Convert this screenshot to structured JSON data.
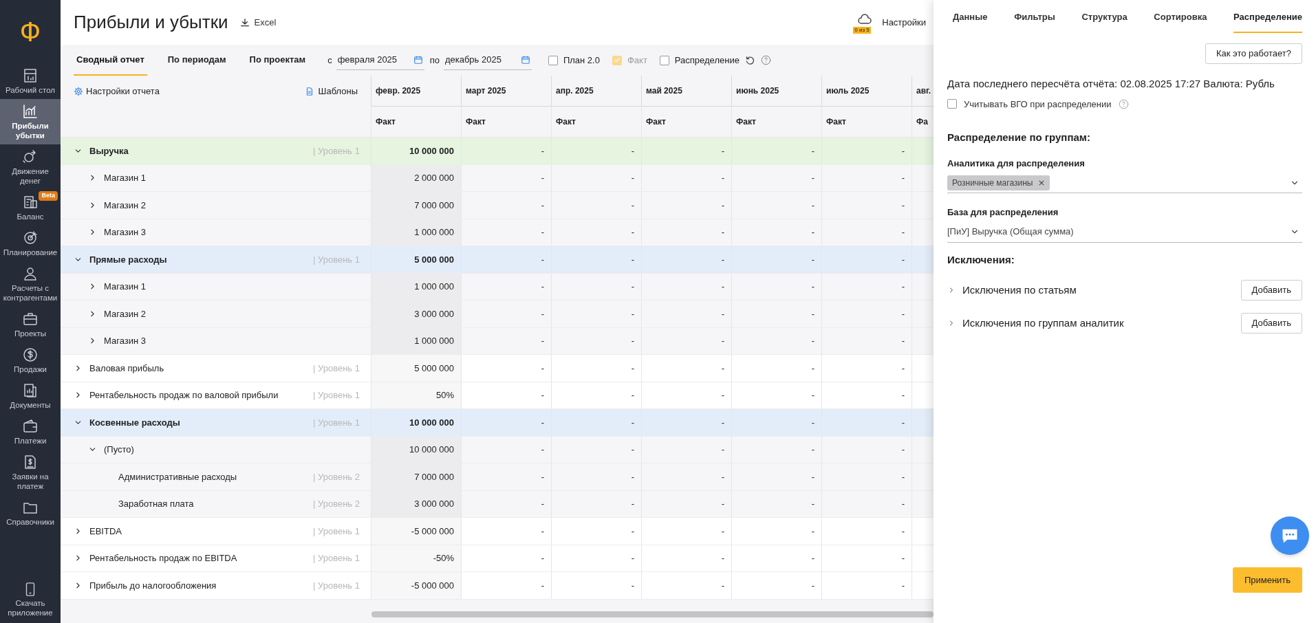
{
  "logo": "Ф",
  "sidebar": {
    "items": [
      {
        "label": "Рабочий стол",
        "selected": false
      },
      {
        "label": "Прибыли убытки",
        "selected": true
      },
      {
        "label": "Движение денег",
        "selected": false
      },
      {
        "label": "Баланс",
        "selected": false,
        "badge": "Beta"
      },
      {
        "label": "Планирование",
        "selected": false
      },
      {
        "label": "Расчеты с контрагентами",
        "selected": false
      },
      {
        "label": "Проекты",
        "selected": false
      },
      {
        "label": "Продажи",
        "selected": false
      },
      {
        "label": "Документы",
        "selected": false
      },
      {
        "label": "Платежи",
        "selected": false
      },
      {
        "label": "Заявки на платеж",
        "selected": false
      },
      {
        "label": "Справочники",
        "selected": false
      }
    ],
    "bottom": "Скачать приложение"
  },
  "header": {
    "title": "Прибыли и убытки",
    "export": "Excel",
    "counter": "0 из 5",
    "settings": "Настройки"
  },
  "toolbar": {
    "tabs": [
      {
        "label": "Сводный отчет",
        "selected": true
      },
      {
        "label": "По периодам",
        "selected": false
      },
      {
        "label": "По проектам",
        "selected": false
      }
    ],
    "from_label": "с",
    "from": "февраля 2025",
    "to_label": "по",
    "to": "декабрь 2025",
    "checks": [
      {
        "label": "План 2.0",
        "checked": false,
        "disabled": false
      },
      {
        "label": "Факт",
        "checked": true,
        "disabled": true
      },
      {
        "label": "Распределение",
        "checked": false,
        "disabled": false
      }
    ]
  },
  "table": {
    "settings": "Настройки отчета",
    "templates": "Шаблоны",
    "columns": [
      {
        "month": "февр. 2025",
        "sub": "Факт"
      },
      {
        "month": "март 2025",
        "sub": "Факт"
      },
      {
        "month": "апр. 2025",
        "sub": "Факт"
      },
      {
        "month": "май 2025",
        "sub": "Факт"
      },
      {
        "month": "июнь 2025",
        "sub": "Факт"
      },
      {
        "month": "июль 2025",
        "sub": "Факт"
      },
      {
        "month": "авг.",
        "sub": "Фа"
      }
    ],
    "rows": [
      {
        "label": "Выручка",
        "level": "| Уровень 1",
        "expanded": true,
        "bold": true,
        "color": "#e6f4e0",
        "values": [
          "10 000 000",
          "-",
          "-",
          "-",
          "-",
          "-"
        ],
        "children": [
          {
            "label": "Магазин 1",
            "expanded": false,
            "values": [
              "2 000 000",
              "-",
              "-",
              "-",
              "-",
              "-"
            ]
          },
          {
            "label": "Магазин 2",
            "expanded": false,
            "values": [
              "7 000 000",
              "-",
              "-",
              "-",
              "-",
              "-"
            ]
          },
          {
            "label": "Магазин 3",
            "expanded": false,
            "values": [
              "1 000 000",
              "-",
              "-",
              "-",
              "-",
              "-"
            ]
          }
        ]
      },
      {
        "label": "Прямые расходы",
        "level": "| Уровень 1",
        "expanded": true,
        "bold": true,
        "color": "#e3edfa",
        "values": [
          "5 000 000",
          "-",
          "-",
          "-",
          "-",
          "-"
        ],
        "children": [
          {
            "label": "Магазин 1",
            "expanded": false,
            "values": [
              "1 000 000",
              "-",
              "-",
              "-",
              "-",
              "-"
            ]
          },
          {
            "label": "Магазин 2",
            "expanded": false,
            "values": [
              "3 000 000",
              "-",
              "-",
              "-",
              "-",
              "-"
            ]
          },
          {
            "label": "Магазин 3",
            "expanded": false,
            "values": [
              "1 000 000",
              "-",
              "-",
              "-",
              "-",
              "-"
            ]
          }
        ]
      },
      {
        "label": "Валовая прибыль",
        "level": "| Уровень 1",
        "expanded": false,
        "values": [
          "5 000 000",
          "-",
          "-",
          "-",
          "-",
          "-"
        ]
      },
      {
        "label": "Рентабельность продаж по валовой прибыли",
        "level": "| Уровень 1",
        "expanded": false,
        "values": [
          "50%",
          "-",
          "-",
          "-",
          "-",
          "-"
        ]
      },
      {
        "label": "Косвенные расходы",
        "level": "| Уровень 1",
        "expanded": true,
        "bold": true,
        "color": "#e3edfa",
        "values": [
          "10 000 000",
          "-",
          "-",
          "-",
          "-",
          "-"
        ],
        "children": [
          {
            "label": "(Пусто)",
            "expanded": true,
            "values": [
              "10 000 000",
              "-",
              "-",
              "-",
              "-",
              "-"
            ],
            "children": [
              {
                "label": "Административные расходы",
                "level": "| Уровень 2",
                "values": [
                  "7 000 000",
                  "-",
                  "-",
                  "-",
                  "-",
                  "-"
                ]
              },
              {
                "label": "Заработная плата",
                "level": "| Уровень 2",
                "values": [
                  "3 000 000",
                  "-",
                  "-",
                  "-",
                  "-",
                  "-"
                ]
              }
            ]
          }
        ]
      },
      {
        "label": "EBITDA",
        "level": "| Уровень 1",
        "expanded": false,
        "values": [
          "-5 000 000",
          "-",
          "-",
          "-",
          "-",
          "-"
        ]
      },
      {
        "label": "Рентабельность продаж по EBITDA",
        "level": "| Уровень 1",
        "expanded": false,
        "values": [
          "-50%",
          "-",
          "-",
          "-",
          "-",
          "-"
        ]
      },
      {
        "label": "Прибыль до налогообложения",
        "level": "| Уровень 1",
        "expanded": false,
        "values": [
          "-5 000 000",
          "-",
          "-",
          "-",
          "-",
          "-"
        ]
      }
    ]
  },
  "panel": {
    "tabs": [
      {
        "label": "Данные",
        "selected": false
      },
      {
        "label": "Фильтры",
        "selected": false
      },
      {
        "label": "Структура",
        "selected": false
      },
      {
        "label": "Сортировка",
        "selected": false
      },
      {
        "label": "Распределение",
        "selected": true
      }
    ],
    "help_button": "Как это работает?",
    "info": "Дата последнего пересчёта отчёта: 02.08.2025 17:27 Валюта: Рубль",
    "vgo": {
      "label": "Учитывать ВГО при распределении",
      "checked": false
    },
    "section": "Распределение по группам:",
    "analytics_label": "Аналитика для распределения",
    "analytics_chips": [
      "Розничные магазины"
    ],
    "base_label": "База для распределения",
    "base_value": "[ПиУ] Выручка (Общая сумма)",
    "exclusions_title": "Исключения:",
    "exclusions": [
      {
        "label": "Исключения по статьям",
        "expanded": false,
        "button": "Добавить"
      },
      {
        "label": "Исключения по группам аналитик",
        "expanded": false,
        "button": "Добавить"
      }
    ],
    "apply": "Применить"
  }
}
